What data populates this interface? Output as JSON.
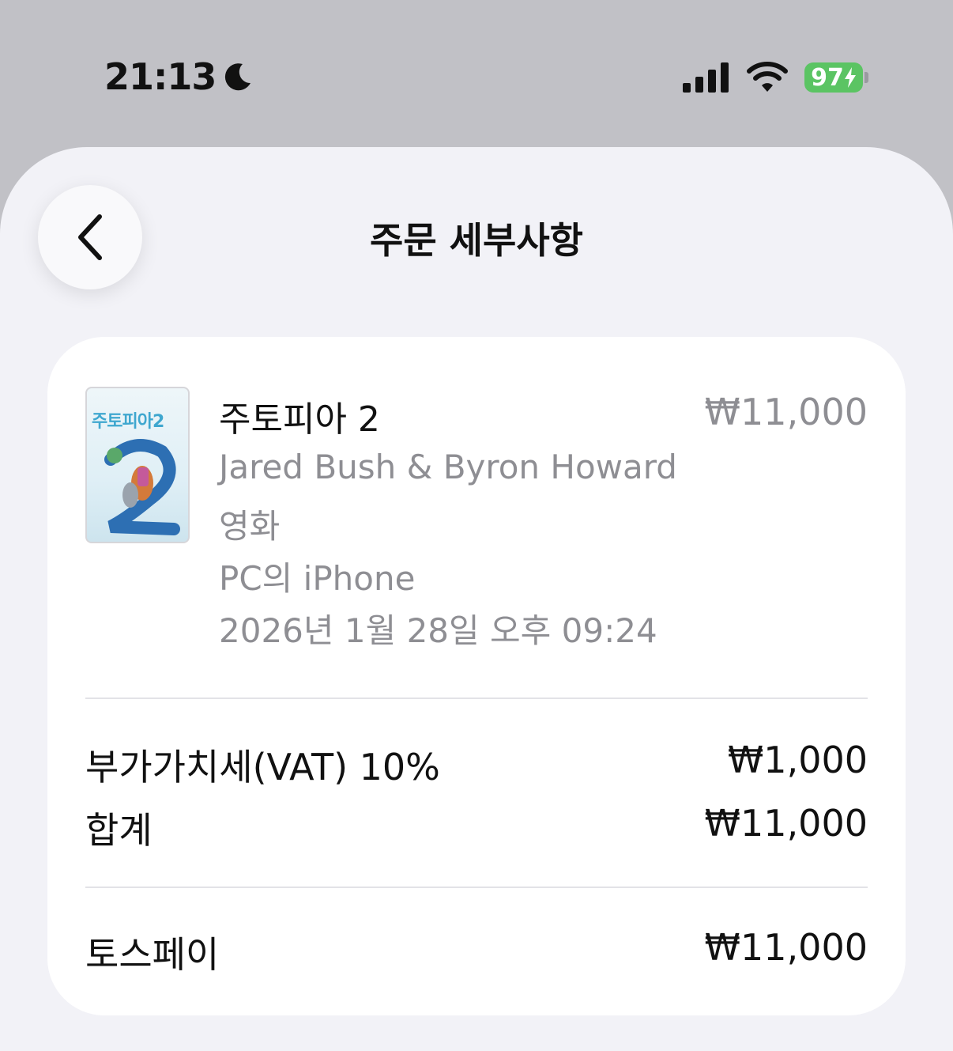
{
  "status_bar": {
    "time": "21:13",
    "focus_icon": "moon-icon",
    "battery_level": "97",
    "battery_color": "#5bc463"
  },
  "header": {
    "title": "주문 세부사항",
    "back_icon": "chevron-left-icon"
  },
  "item": {
    "poster_title": "주토피아2",
    "title": "주토피아 2",
    "price": "₩11,000",
    "creators": "Jared Bush & Byron Howard",
    "category": "영화",
    "device": "PC의 iPhone",
    "purchase_date": "2026년 1월 28일 오후 09:24"
  },
  "summary": {
    "vat_label": "부가가치세(VAT) 10%",
    "vat_value": "₩1,000",
    "total_label": "합계",
    "total_value": "₩11,000"
  },
  "payment": {
    "method_label": "토스페이",
    "method_value": "₩11,000"
  }
}
